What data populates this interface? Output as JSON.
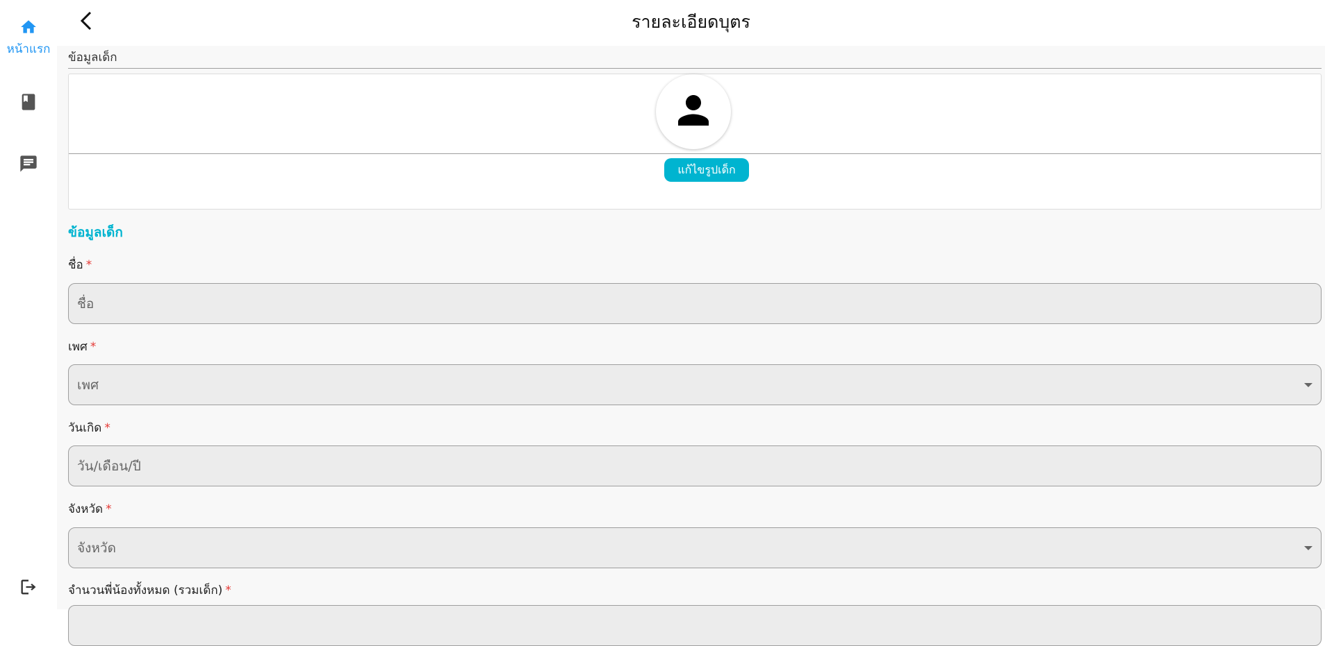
{
  "sidebar": {
    "home_label": "หน้าแรก",
    "accent": "#2196f3",
    "items": [
      {
        "icon": "home-icon"
      },
      {
        "icon": "book-icon"
      },
      {
        "icon": "chat-icon"
      },
      {
        "icon": "logout-icon"
      }
    ]
  },
  "header": {
    "title": "รายละเอียดบุตร",
    "back_icon": "chevron-left-icon"
  },
  "photo_section": {
    "caption": "ข้อมูลเด็ก",
    "avatar_icon": "person-icon",
    "edit_button": "แก้ไขรูปเด็ก",
    "button_color": "#00b4d0"
  },
  "form": {
    "heading": "ข้อมูลเด็ก",
    "required_mark": "*",
    "fields": [
      {
        "label": "ชื่อ",
        "placeholder": "ชื่อ",
        "type": "text"
      },
      {
        "label": "เพศ",
        "placeholder": "เพศ",
        "type": "select"
      },
      {
        "label": "วันเกิด",
        "placeholder": "วัน/เดือน/ปี",
        "type": "date"
      },
      {
        "label": "จังหวัด",
        "placeholder": "จังหวัด",
        "type": "select"
      },
      {
        "label": "จำนวนพี่น้องทั้งหมด (รวมเด็ก)",
        "placeholder": "",
        "type": "number"
      }
    ]
  }
}
